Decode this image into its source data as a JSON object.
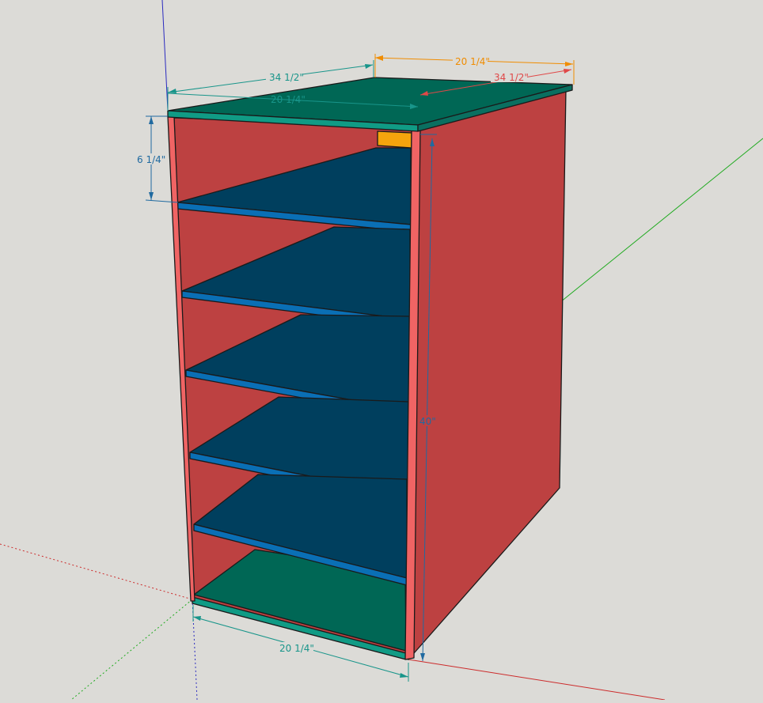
{
  "model": {
    "colors": {
      "background": "#dcdbd7",
      "side_panel": "#bd4141",
      "side_panel_edge": "#f06464",
      "shelf_face": "#003f5e",
      "shelf_edge": "#0a6fb5",
      "top_bottom_face": "#006755",
      "top_bottom_edge": "#109b85",
      "block": "#f5a40d",
      "dim_teal": "#18958a",
      "dim_orange": "#f08c00",
      "dim_red": "#e04848",
      "dim_blue": "#206aa0",
      "axis_red": "#cc2b2b",
      "axis_green": "#1faa1f",
      "axis_blue": "#2a2abf"
    }
  },
  "dimensions": {
    "top_length": "34 1/2\"",
    "top_width": "20 1/4\"",
    "top_depth_label": "20 1/4\"",
    "top_right_length": "34 1/2\"",
    "shelf_gap": "6 1/4\"",
    "height": "40\"",
    "bottom_width": "20 1/4\""
  }
}
